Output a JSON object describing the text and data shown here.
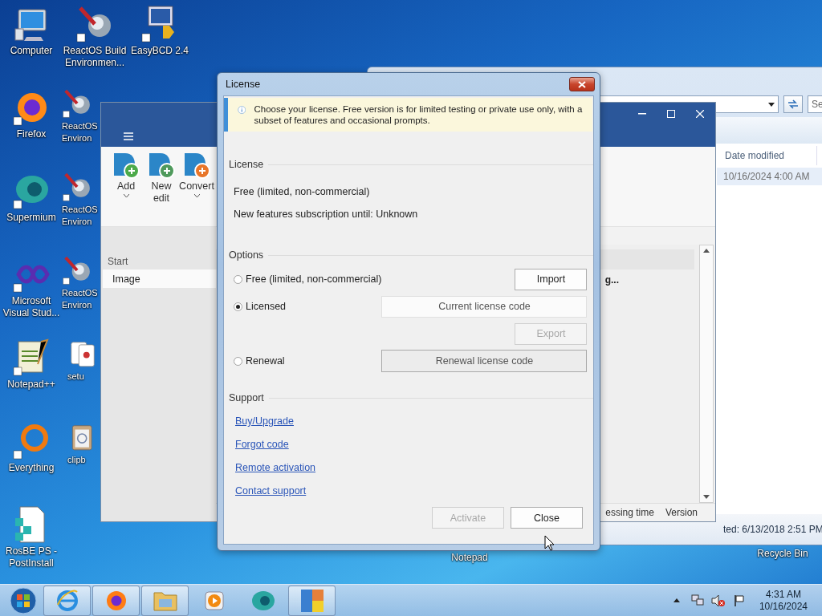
{
  "desktop_icons": [
    {
      "label": "Computer",
      "kind": "computer"
    },
    {
      "label": "ReactOS Build Environmen...",
      "kind": "reactos"
    },
    {
      "label": "EasyBCD 2.4",
      "kind": "easybcd"
    },
    {
      "label": "Firefox",
      "kind": "firefox"
    },
    {
      "label": "ReactOS Environ",
      "kind": "reactos"
    },
    {
      "label": "Supermium",
      "kind": "supermium"
    },
    {
      "label": "ReactOS Environ",
      "kind": "reactos"
    },
    {
      "label": "Microsoft Visual Stud...",
      "kind": "vs"
    },
    {
      "label": "ReactOS Environ",
      "kind": "reactos"
    },
    {
      "label": "Notepad++",
      "kind": "notepad"
    },
    {
      "label": "setu",
      "kind": "cards"
    },
    {
      "label": "Everything",
      "kind": "everything"
    },
    {
      "label": "clipb",
      "kind": "clipboard"
    },
    {
      "label": "RosBE PS - PostInstall",
      "kind": "registry"
    },
    {
      "label": "Notepad",
      "kind": "hidden"
    },
    {
      "label": "Recycle Bin",
      "kind": "hidden"
    }
  ],
  "explorer": {
    "search_placeholder": "Se",
    "column": "Date modified",
    "row_date": "10/16/2024 4:00 AM",
    "status": "ted: 6/13/2018 2:51 PM"
  },
  "app": {
    "toolbar": [
      {
        "label": "Add",
        "kind": "add",
        "dropdown": true
      },
      {
        "label": "New edit",
        "kind": "edit",
        "dropdown": false
      },
      {
        "label": "Convert",
        "kind": "convert",
        "dropdown": true
      }
    ],
    "sidebar": {
      "heading": "Start",
      "items": [
        {
          "label": "Image",
          "selected": true
        }
      ]
    },
    "list_item": "g...",
    "footer_columns": [
      "essing time",
      "Version"
    ]
  },
  "dialog": {
    "title": "License",
    "info": "Choose your license. Free version is for limited testing or private use only, with a subset of features and occasional prompts.",
    "license_section": {
      "heading": "License",
      "lines": [
        "Free (limited, non-commercial)",
        "New features subscription until: Unknown"
      ]
    },
    "options_section": {
      "heading": "Options",
      "options": [
        {
          "label": "Free (limited, non-commercial)",
          "selected": false
        },
        {
          "label": "Licensed",
          "selected": true
        },
        {
          "label": "Renewal",
          "selected": false
        }
      ],
      "import_button": {
        "label": "Import",
        "disabled": false
      },
      "license_code_field": {
        "placeholder": "Current license code"
      },
      "export_button": {
        "label": "Export",
        "disabled": true
      },
      "renewal_button": {
        "label": "Renewal license code"
      }
    },
    "support_section": {
      "heading": "Support",
      "links": [
        "Buy/Upgrade",
        "Forgot code",
        "Remote activation",
        "Contact support"
      ]
    },
    "buttons": [
      {
        "label": "Activate",
        "disabled": true
      },
      {
        "label": "Close",
        "disabled": false
      }
    ]
  },
  "taskbar": {
    "pinned": [
      {
        "kind": "ie",
        "running": true
      },
      {
        "kind": "firefox",
        "running": true
      },
      {
        "kind": "folder",
        "running": true
      },
      {
        "kind": "media",
        "running": false
      },
      {
        "kind": "supermium",
        "running": false
      },
      {
        "kind": "app",
        "running": true
      }
    ],
    "clock": {
      "time": "4:31 AM",
      "date": "10/16/2024"
    }
  }
}
